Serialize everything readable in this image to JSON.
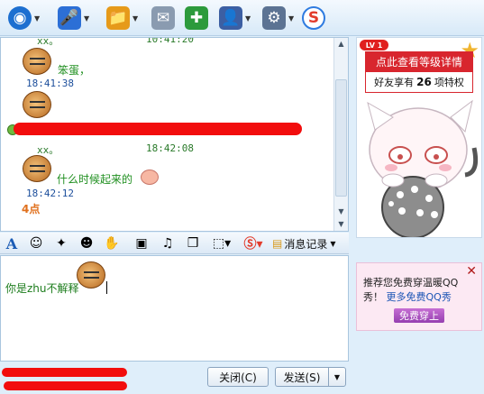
{
  "toolbar": {
    "colors": {
      "webcam": "#1d6fd0",
      "voice": "#2c6fd6",
      "file": "#e69a1a",
      "mail": "#8a9bb0",
      "addfriend": "#2c9a3c",
      "group": "#3c5fa3",
      "app": "#5c7393",
      "soso": "#2e7be0"
    },
    "icons": [
      "webcam-icon",
      "microphone-icon",
      "folder-icon",
      "mail-icon",
      "add-friend-icon",
      "user-group-icon",
      "apps-icon",
      "soso-icon"
    ]
  },
  "chat": {
    "top_partial_time": "10:41:20",
    "m1": {
      "sender": "xx。",
      "text": "笨蛋，",
      "time": "18:41:38"
    },
    "m3": {
      "sender": "xx。",
      "time_header": "18:42:08",
      "text": "什么时候起来的",
      "time": "18:42:12"
    },
    "note": "4点"
  },
  "format_bar": {
    "history_label": "消息记录"
  },
  "input": {
    "text": "你是zhu不解释"
  },
  "buttons": {
    "close": "关闭(C)",
    "send": "发送(S)"
  },
  "level": {
    "badge": "LV 1",
    "header": "点此查看等级详情",
    "privileges_prefix": "好友享有",
    "privileges_count": "26",
    "privileges_suffix": "项特权"
  },
  "ad": {
    "line1": "推荐您免费穿温暖QQ",
    "line2_prefix": "秀！",
    "link": "更多免费QQ秀",
    "button": "免费穿上",
    "close": "✕"
  }
}
